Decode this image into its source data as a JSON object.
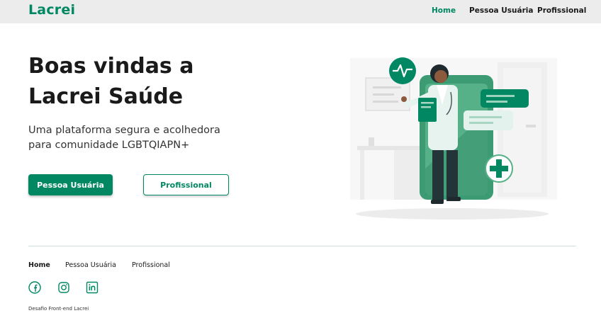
{
  "header": {
    "logo": "Lacrei",
    "nav": [
      {
        "label": "Home",
        "active": true
      },
      {
        "label": "Pessoa Usuária",
        "active": false
      },
      {
        "label": "Profissional",
        "active": false
      }
    ]
  },
  "hero": {
    "title": "Boas vindas a Lacrei Saúde",
    "subtitle": "Uma plataforma segura e acolhedora para comunidade LGBTQIAPN+",
    "primary_button": "Pessoa Usuária",
    "secondary_button": "Profissional"
  },
  "footer": {
    "nav": [
      {
        "label": "Home",
        "active": true
      },
      {
        "label": "Pessoa Usuária",
        "active": false
      },
      {
        "label": "Profissional",
        "active": false
      }
    ],
    "social": [
      "facebook-icon",
      "instagram-icon",
      "linkedin-icon"
    ],
    "copyright": "Desafio Front-end Lacrei"
  },
  "colors": {
    "brand": "#018762",
    "topbar": "#ececec",
    "text": "#1a1a1a"
  }
}
